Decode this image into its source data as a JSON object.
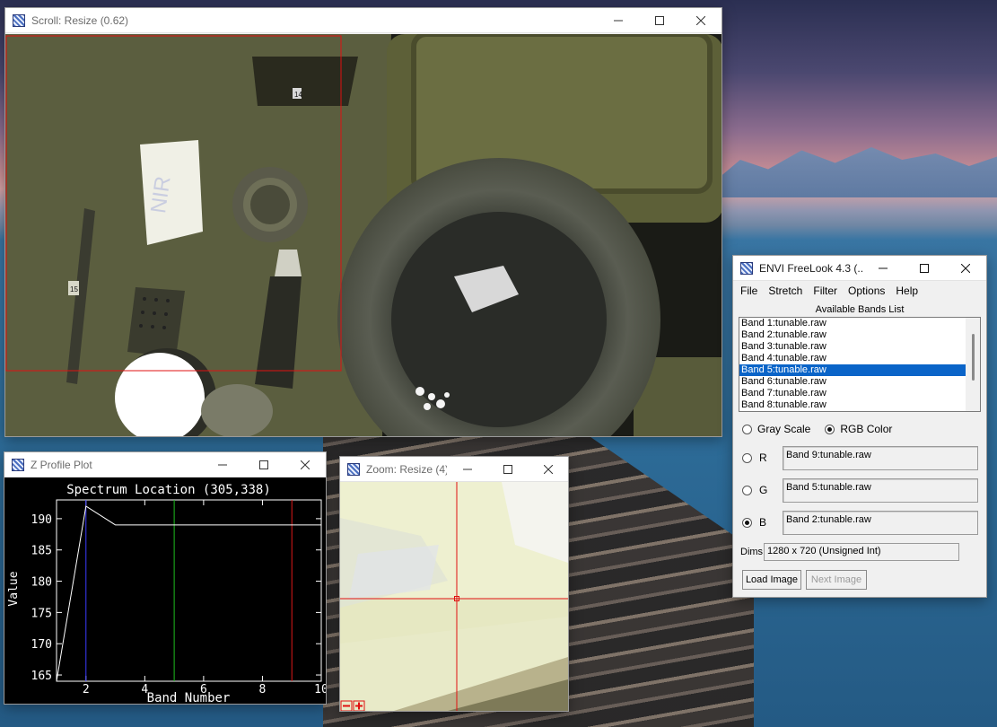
{
  "scroll_window": {
    "title": "Scroll: Resize (0.62)",
    "scene_labels": {
      "card": "NIR",
      "tag1": "15",
      "tag2": "14"
    }
  },
  "zprofile_window": {
    "title": "Z Profile Plot"
  },
  "zoom_window": {
    "title": "Zoom: Resize (4)"
  },
  "envi_window": {
    "title": "ENVI FreeLook 4.3 (...",
    "menu": [
      "File",
      "Stretch",
      "Filter",
      "Options",
      "Help"
    ],
    "bands_label": "Available Bands List",
    "bands": [
      "Band 1:tunable.raw",
      "Band 2:tunable.raw",
      "Band 3:tunable.raw",
      "Band 4:tunable.raw",
      "Band 5:tunable.raw",
      "Band 6:tunable.raw",
      "Band 7:tunable.raw",
      "Band 8:tunable.raw"
    ],
    "selected_band_index": 4,
    "mode_gray": "Gray Scale",
    "mode_rgb": "RGB Color",
    "r_label": "R",
    "g_label": "G",
    "b_label": "B",
    "r_value": "Band 9:tunable.raw",
    "g_value": "Band 5:tunable.raw",
    "b_value": "Band 2:tunable.raw",
    "dims_label": "Dims",
    "dims_value": "1280 x 720 (Unsigned Int)",
    "load_button": "Load Image",
    "next_button": "Next Image"
  },
  "chart_data": {
    "type": "line",
    "title": "Spectrum Location (305,338)",
    "xlabel": "Band Number",
    "ylabel": "Value",
    "xlim": [
      1,
      10
    ],
    "ylim": [
      164,
      193
    ],
    "xticks": [
      2,
      4,
      6,
      8,
      10
    ],
    "xtick_labels": [
      "2",
      "4",
      "6",
      "8",
      "10"
    ],
    "yticks": [
      165,
      170,
      175,
      180,
      185,
      190
    ],
    "ytick_labels": [
      "165",
      "170",
      "175",
      "180",
      "185",
      "190"
    ],
    "series": [
      {
        "x": [
          1,
          2,
          3,
          4,
          5,
          6,
          7,
          8,
          9,
          10
        ],
        "y": [
          164,
          192,
          189,
          189,
          189,
          189,
          189,
          189,
          189,
          189
        ]
      }
    ],
    "markers": [
      {
        "x": 2,
        "color": "#3a3aff"
      },
      {
        "x": 5,
        "color": "#1fbf1f"
      },
      {
        "x": 9,
        "color": "#e01a1a"
      }
    ],
    "colors": {
      "background": "#000000",
      "axes": "#ffffff",
      "line": "#ffffff"
    }
  }
}
